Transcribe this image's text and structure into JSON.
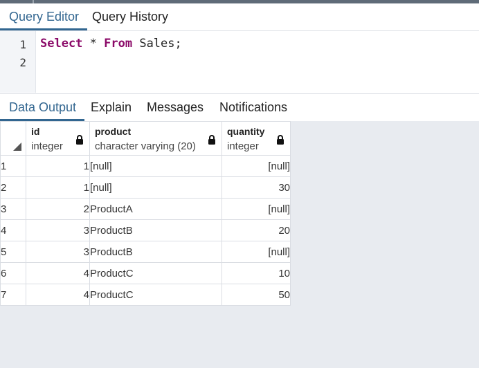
{
  "editor_tabs": [
    {
      "label": "Query Editor",
      "active": true
    },
    {
      "label": "Query History",
      "active": false
    }
  ],
  "editor": {
    "line_numbers": [
      "1",
      "2"
    ],
    "line1": {
      "kw1": "Select",
      "sym": " * ",
      "kw2": "From",
      "rest": " Sales;"
    }
  },
  "output_tabs": [
    {
      "label": "Data Output",
      "active": true
    },
    {
      "label": "Explain",
      "active": false
    },
    {
      "label": "Messages",
      "active": false
    },
    {
      "label": "Notifications",
      "active": false
    }
  ],
  "grid": {
    "columns": [
      {
        "name": "id",
        "type": "integer",
        "locked": true
      },
      {
        "name": "product",
        "type": "character varying (20)",
        "locked": true
      },
      {
        "name": "quantity",
        "type": "integer",
        "locked": true
      }
    ],
    "rows": [
      {
        "num": "1",
        "id": "1",
        "product": "[null]",
        "quantity": "[null]"
      },
      {
        "num": "2",
        "id": "1",
        "product": "[null]",
        "quantity": "30"
      },
      {
        "num": "3",
        "id": "2",
        "product": "ProductA",
        "quantity": "[null]"
      },
      {
        "num": "4",
        "id": "3",
        "product": "ProductB",
        "quantity": "20"
      },
      {
        "num": "5",
        "id": "3",
        "product": "ProductB",
        "quantity": "[null]"
      },
      {
        "num": "6",
        "id": "4",
        "product": "ProductC",
        "quantity": "10"
      },
      {
        "num": "7",
        "id": "4",
        "product": "ProductC",
        "quantity": "50"
      }
    ]
  }
}
